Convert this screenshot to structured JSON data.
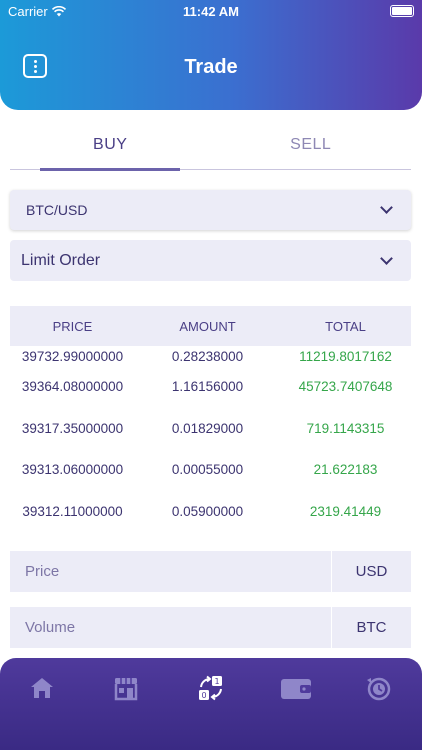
{
  "status_bar": {
    "carrier": "Carrier",
    "time": "11:42 AM"
  },
  "header": {
    "title": "Trade",
    "menu_icon": "more-vertical-icon"
  },
  "tabs": [
    {
      "label": "BUY",
      "active": true
    },
    {
      "label": "SELL",
      "active": false
    }
  ],
  "pair_select": {
    "value": "BTC/USD"
  },
  "order_type_select": {
    "value": "Limit Order"
  },
  "order_book": {
    "columns": [
      "PRICE",
      "AMOUNT",
      "TOTAL"
    ],
    "rows": [
      [
        "39732.99000000",
        "0.28238000",
        "11219.8017162"
      ],
      [
        "39364.08000000",
        "1.16156000",
        "45723.7407648"
      ],
      [
        "39317.35000000",
        "0.01829000",
        "719.1143315"
      ],
      [
        "39313.06000000",
        "0.00055000",
        "21.622183"
      ],
      [
        "39312.11000000",
        "0.05900000",
        "2319.41449"
      ]
    ]
  },
  "price_input": {
    "placeholder": "Price",
    "unit": "USD"
  },
  "volume_input": {
    "placeholder": "Volume",
    "unit": "BTC"
  },
  "bottom_nav": {
    "items": [
      "home-icon",
      "market-icon",
      "trade-icon",
      "wallet-icon",
      "history-icon"
    ],
    "active": "trade-icon"
  },
  "colors": {
    "header_start": "#1c9ad8",
    "header_end": "#5a3aaa",
    "nav_bg": "#3a2a84",
    "text": "#3c3470",
    "total_green": "#35a64a",
    "field_bg": "#ececf7"
  }
}
